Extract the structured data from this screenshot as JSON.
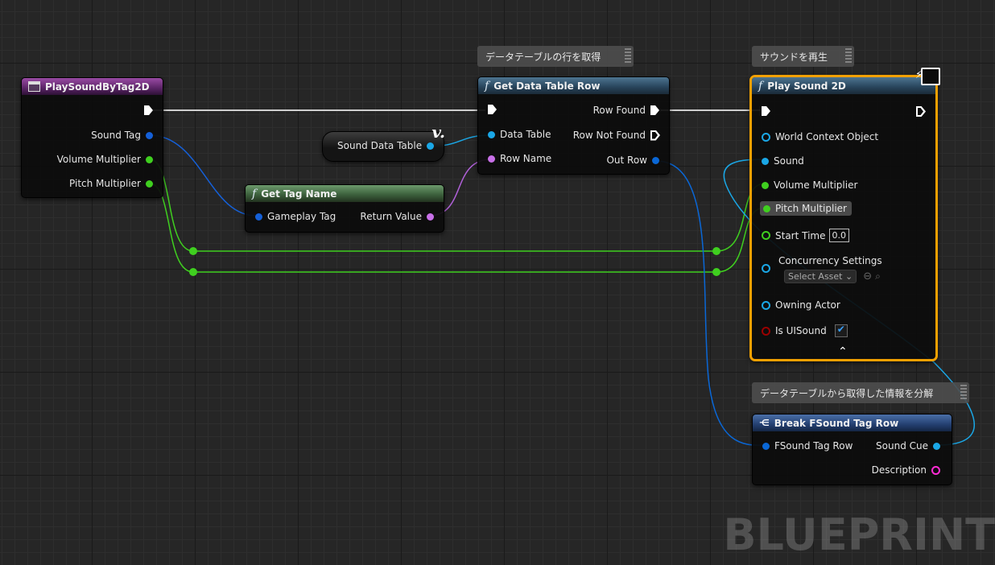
{
  "event_node": {
    "title": "PlaySoundByTag2D",
    "outputs": [
      "Sound Tag",
      "Volume Multiplier",
      "Pitch Multiplier"
    ]
  },
  "get_tag_name": {
    "title": "Get Tag Name",
    "input": "Gameplay Tag",
    "output": "Return Value"
  },
  "variable": {
    "label": "Sound Data Table"
  },
  "get_data_table_row": {
    "comment": "データテーブルの行を取得",
    "title": "Get Data Table Row",
    "inputs": [
      "Data Table",
      "Row Name"
    ],
    "outputs": [
      "Row Found",
      "Row Not Found",
      "Out Row"
    ]
  },
  "play_sound": {
    "comment": "サウンドを再生",
    "title": "Play Sound 2D",
    "inputs": {
      "world_context": "World Context Object",
      "sound": "Sound",
      "volume": "Volume Multiplier",
      "pitch": "Pitch Multiplier",
      "start_time": "Start Time",
      "start_time_value": "0.0",
      "concurrency": "Concurrency Settings",
      "concurrency_select": "Select Asset",
      "owning_actor": "Owning Actor",
      "is_ui_sound": "Is UISound"
    },
    "is_ui_sound_checked": true
  },
  "break_node": {
    "comment": "データテーブルから取得した情報を分解",
    "title": "Break FSound Tag Row",
    "input": "FSound Tag Row",
    "outputs": [
      "Sound Cue",
      "Description"
    ]
  },
  "watermark": "BLUEPRINT",
  "colors": {
    "exec": "#ffffff",
    "object": "#0b5bd6",
    "table": "#1aa7e6",
    "float": "#3fcf1f",
    "name": "#c870e8",
    "struct": "#0a67d6",
    "string": "#ff2ad5",
    "bool": "#9a0000",
    "selection": "#f2a000"
  }
}
